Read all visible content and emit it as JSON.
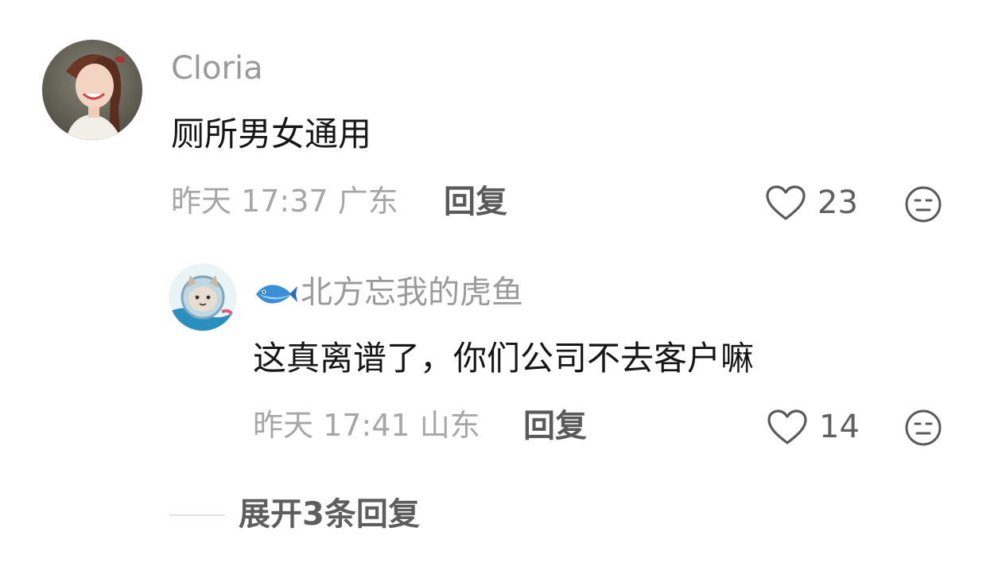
{
  "comment": {
    "username": "Cloria",
    "text": "厕所男女通用",
    "time": "昨天 17:37",
    "location": "广东",
    "reply_label": "回复",
    "like_count": "23",
    "icons": {
      "like": "heart-outline-icon",
      "dislike": "meh-face-icon"
    }
  },
  "reply": {
    "badge_icon": "fish-icon",
    "username": "北方忘我的虎鱼",
    "text": "这真离谱了，你们公司不去客户嘛",
    "time": "昨天 17:41",
    "location": "山东",
    "reply_label": "回复",
    "like_count": "14",
    "icons": {
      "like": "heart-outline-icon",
      "dislike": "meh-face-icon"
    }
  },
  "expand_replies": "展开3条回复",
  "colors": {
    "name": "#9a9a9a",
    "content": "#161616",
    "meta": "#a6a6a6",
    "icon": "#5a5a5a",
    "divider": "#e2e2e2"
  }
}
